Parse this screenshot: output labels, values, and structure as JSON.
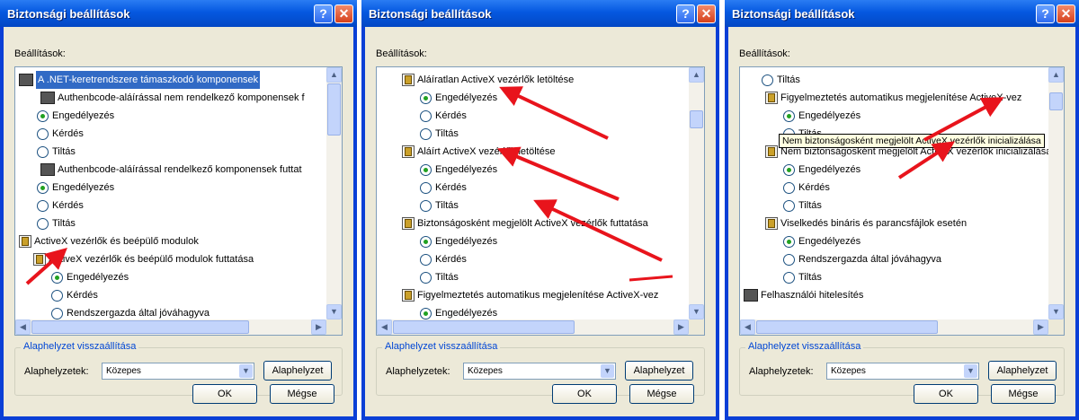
{
  "colors": {
    "title_bar": "#0558e0",
    "selection": "#316ac5",
    "arrow": "#e8141c",
    "group_title": "#0046d5"
  },
  "dialogs": [
    {
      "title": "Biztonsági beállítások",
      "settings_label": "Beállítások:",
      "items": [
        {
          "kind": "group",
          "text": "A .NET-keretrendszere támaszkodó komponensek",
          "selected": true
        },
        {
          "kind": "sub",
          "text": "Authenbcode-aláírással nem rendelkező komponensek f"
        },
        {
          "kind": "radio",
          "text": "Engedélyezés",
          "checked": true
        },
        {
          "kind": "radio",
          "text": "Kérdés",
          "checked": false
        },
        {
          "kind": "radio",
          "text": "Tiltás",
          "checked": false
        },
        {
          "kind": "sub",
          "text": "Authenbcode-aláírással rendelkező komponensek futtat"
        },
        {
          "kind": "radio",
          "text": "Engedélyezés",
          "checked": true
        },
        {
          "kind": "radio",
          "text": "Kérdés",
          "checked": false
        },
        {
          "kind": "radio",
          "text": "Tiltás",
          "checked": false
        },
        {
          "kind": "check",
          "text": "ActiveX vezérlők és beépülő modulok"
        },
        {
          "kind": "check",
          "text": "ActiveX vezérlők és beépülő modulok futtatása"
        },
        {
          "kind": "radio",
          "text": "Engedélyezés",
          "checked": true
        },
        {
          "kind": "radio",
          "text": "Kérdés",
          "checked": false
        },
        {
          "kind": "radio",
          "text": "Rendszergazda által jóváhagyva",
          "checked": false
        }
      ],
      "reset_group_title": "Alaphelyzet visszaállítása",
      "reset_label": "Alaphelyzetek:",
      "reset_value": "Közepes",
      "reset_button": "Alaphelyzet",
      "ok_button": "OK",
      "cancel_button": "Mégse"
    },
    {
      "title": "Biztonsági beállítások",
      "settings_label": "Beállítások:",
      "items": [
        {
          "kind": "check",
          "text": "Aláíratlan ActiveX vezérlők letöltése"
        },
        {
          "kind": "radio",
          "text": "Engedélyezés",
          "checked": true
        },
        {
          "kind": "radio",
          "text": "Kérdés",
          "checked": false
        },
        {
          "kind": "radio",
          "text": "Tiltás",
          "checked": false
        },
        {
          "kind": "check",
          "text": "Aláírt ActiveX vezérlők letöltése"
        },
        {
          "kind": "radio",
          "text": "Engedélyezés",
          "checked": true
        },
        {
          "kind": "radio",
          "text": "Kérdés",
          "checked": false
        },
        {
          "kind": "radio",
          "text": "Tiltás",
          "checked": false
        },
        {
          "kind": "check",
          "text": "Biztonságosként megjelölt ActiveX vezérlők futtatása"
        },
        {
          "kind": "radio",
          "text": "Engedélyezés",
          "checked": true
        },
        {
          "kind": "radio",
          "text": "Kérdés",
          "checked": false
        },
        {
          "kind": "radio",
          "text": "Tiltás",
          "checked": false
        },
        {
          "kind": "check",
          "text": "Figyelmeztetés automatikus megjelenítése ActiveX-vez"
        },
        {
          "kind": "radio",
          "text": "Engedélyezés",
          "checked": true
        }
      ],
      "reset_group_title": "Alaphelyzet visszaállítása",
      "reset_label": "Alaphelyzetek:",
      "reset_value": "Közepes",
      "reset_button": "Alaphelyzet",
      "ok_button": "OK",
      "cancel_button": "Mégse"
    },
    {
      "title": "Biztonsági beállítások",
      "settings_label": "Beállítások:",
      "items": [
        {
          "kind": "radio",
          "text": "Tiltás",
          "checked": false
        },
        {
          "kind": "check",
          "text": "Figyelmeztetés automatikus megjelenítése ActiveX-vez"
        },
        {
          "kind": "radio",
          "text": "Engedélyezés",
          "checked": true
        },
        {
          "kind": "radio",
          "text": "Tiltás",
          "checked": false
        },
        {
          "kind": "check",
          "text": "Nem biztonságosként megjelölt ActiveX vezérlők inicializálása"
        },
        {
          "kind": "radio",
          "text": "Engedélyezés",
          "checked": true
        },
        {
          "kind": "radio",
          "text": "Kérdés",
          "checked": false
        },
        {
          "kind": "radio",
          "text": "Tiltás",
          "checked": false
        },
        {
          "kind": "check",
          "text": "Viselkedés bináris és parancsfájlok esetén"
        },
        {
          "kind": "radio",
          "text": "Engedélyezés",
          "checked": true
        },
        {
          "kind": "radio",
          "text": "Rendszergazda által jóváhagyva",
          "checked": false
        },
        {
          "kind": "radio",
          "text": "Tiltás",
          "checked": false
        },
        {
          "kind": "group",
          "text": "Felhasználói hitelesítés",
          "selected": false
        }
      ],
      "tooltip": "Nem biztonságosként megjelölt ActiveX vezérlők inicializálása",
      "reset_group_title": "Alaphelyzet visszaállítása",
      "reset_label": "Alaphelyzetek:",
      "reset_value": "Közepes",
      "reset_button": "Alaphelyzet",
      "ok_button": "OK",
      "cancel_button": "Mégse"
    }
  ]
}
